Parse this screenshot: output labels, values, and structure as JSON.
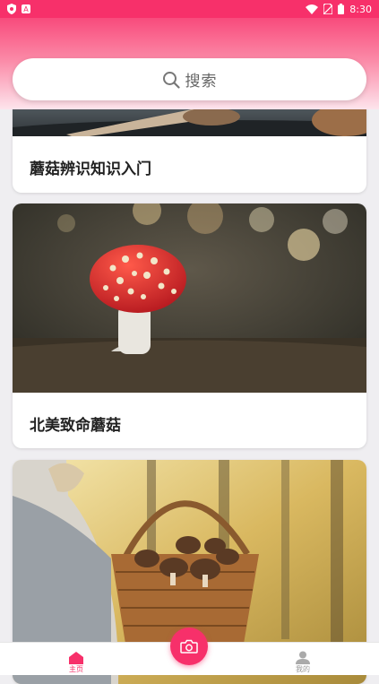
{
  "status_bar": {
    "time": "8:30",
    "left_icons": [
      "shield-icon",
      "a-icon"
    ],
    "right_icons": [
      "wifi-icon",
      "no-sim-icon",
      "battery-icon"
    ]
  },
  "search": {
    "placeholder": "搜索",
    "icon": "search-icon"
  },
  "feed": {
    "cards": [
      {
        "title": "蘑菇辨识知识入门",
        "image": "mushroom-on-log-photo"
      },
      {
        "title": "北美致命蘑菇",
        "image": "red-amanita-mushroom-photo"
      },
      {
        "title": "",
        "image": "mushroom-basket-photo"
      }
    ]
  },
  "tabbar": {
    "tabs": [
      {
        "label": "主页",
        "icon": "home-icon",
        "active": true
      },
      {
        "label": "我的",
        "icon": "person-icon",
        "active": false
      }
    ],
    "center_button_icon": "camera-icon"
  },
  "colors": {
    "accent": "#f7306a",
    "background": "#efeef1",
    "card": "#ffffff",
    "title_text": "#222222",
    "tab_inactive": "#999999"
  }
}
